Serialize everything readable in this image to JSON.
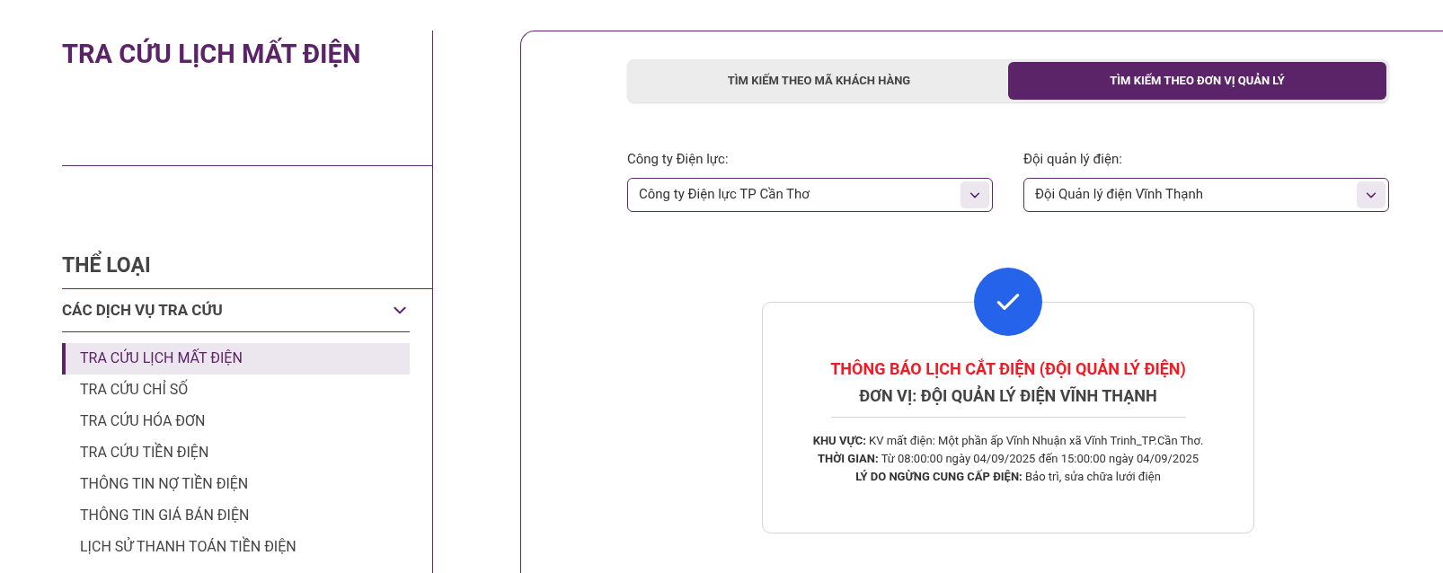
{
  "sidebar": {
    "title": "TRA CỨU LỊCH MẤT ĐIỆN",
    "category_heading": "THỂ LOẠI",
    "group": {
      "label": "CÁC DỊCH VỤ TRA CỨU",
      "expanded": true,
      "items": [
        {
          "label": "TRA CỨU LỊCH MẤT ĐIỆN",
          "selected": true
        },
        {
          "label": "TRA CỨU CHỈ SỐ",
          "selected": false
        },
        {
          "label": "TRA CỨU HÓA ĐƠN",
          "selected": false
        },
        {
          "label": "TRA CỨU TIỀN ĐIỆN",
          "selected": false
        },
        {
          "label": "THÔNG TIN NỢ TIỀN ĐIỆN",
          "selected": false
        },
        {
          "label": "THÔNG TIN GIÁ BÁN ĐIỆN",
          "selected": false
        },
        {
          "label": "LỊCH SỬ THANH TOÁN TIỀN ĐIỆN",
          "selected": false
        }
      ]
    }
  },
  "tabs": [
    {
      "label": "TÌM KIẾM THEO MÃ KHÁCH HÀNG",
      "selected": false
    },
    {
      "label": "TÌM KIẾM THEO ĐƠN VỊ QUẢN LÝ",
      "selected": true
    }
  ],
  "fields": [
    {
      "label": "Công ty Điện lực:",
      "value": "Công ty Điện lực TP Cần Thơ"
    },
    {
      "label": "Đội quản lý điện:",
      "value": "Đội Quản lý điện Vĩnh Thạnh"
    }
  ],
  "notice": {
    "title": "THÔNG BÁO LỊCH CẮT ĐIỆN (ĐỘI QUẢN LÝ ĐIỆN)",
    "unit": "ĐƠN VỊ: ĐỘI QUẢN LÝ ĐIỆN VĨNH THẠNH",
    "lines": [
      "**KHU VỰC:** KV mất điện: Một phần ấp Vĩnh Nhuận xã Vĩnh Trinh_TP.Cần Thơ.",
      "**THỜI GIAN:** Từ 08:00:00 ngày 04/09/2025 đến 15:00:00 ngày 04/09/2025",
      "**LÝ DO NGỪNG CUNG CẤP ĐIỆN:** Bảo trì, sửa chữa lưới điện"
    ]
  }
}
